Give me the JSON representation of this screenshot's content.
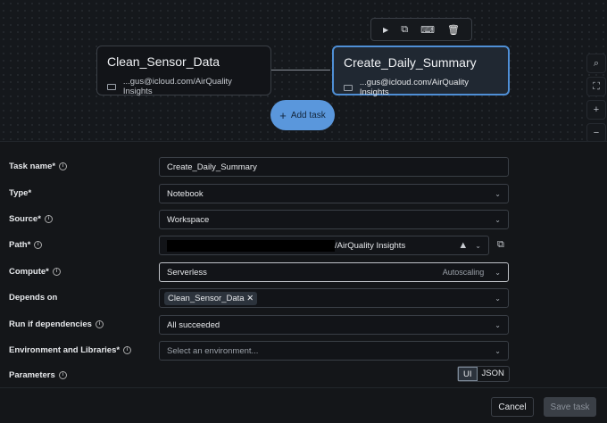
{
  "canvas": {
    "nodes": [
      {
        "title": "Clean_Sensor_Data",
        "path": "...gus@icloud.com/AirQuality Insights"
      },
      {
        "title": "Create_Daily_Summary",
        "path": "...gus@icloud.com/AirQuality Insights"
      }
    ],
    "toolbar": {
      "run": "▶",
      "clone": "⧉",
      "comment": "⌨",
      "delete": "🗑"
    },
    "add_task": "Add task",
    "zoom": {
      "search": "⌕",
      "fit": "⛶",
      "in": "+",
      "out": "−"
    }
  },
  "form": {
    "task_name": {
      "label": "Task name*",
      "value": "Create_Daily_Summary"
    },
    "type": {
      "label": "Type*",
      "value": "Notebook"
    },
    "source": {
      "label": "Source*",
      "value": "Workspace"
    },
    "path": {
      "label": "Path*",
      "value": "/AirQuality Insights"
    },
    "compute": {
      "label": "Compute*",
      "value": "Serverless",
      "hint": "Autoscaling"
    },
    "depends_on": {
      "label": "Depends on",
      "chip": "Clean_Sensor_Data"
    },
    "run_if": {
      "label": "Run if dependencies",
      "value": "All succeeded"
    },
    "environment": {
      "label": "Environment and Libraries*",
      "placeholder": "Select an environment..."
    },
    "parameters": {
      "label": "Parameters",
      "ui": "UI",
      "json": "JSON"
    }
  },
  "footer": {
    "cancel": "Cancel",
    "save": "Save task"
  }
}
